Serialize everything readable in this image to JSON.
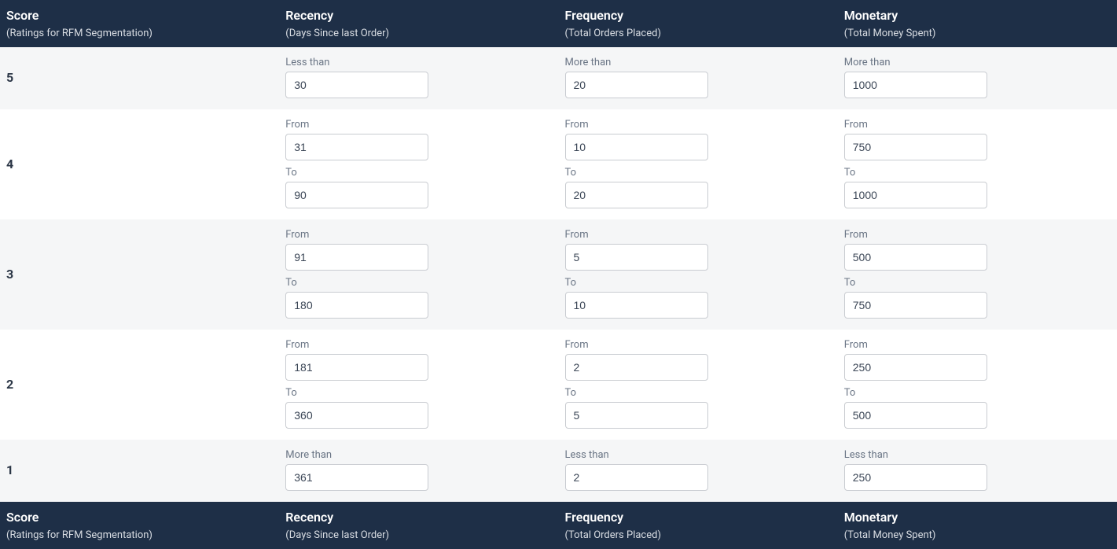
{
  "headers": {
    "score": {
      "title": "Score",
      "sub": "(Ratings for RFM Segmentation)"
    },
    "recency": {
      "title": "Recency",
      "sub": "(Days Since last Order)"
    },
    "frequency": {
      "title": "Frequency",
      "sub": "(Total Orders Placed)"
    },
    "monetary": {
      "title": "Monetary",
      "sub": "(Total Money Spent)"
    }
  },
  "labels": {
    "less_than": "Less than",
    "more_than": "More than",
    "from": "From",
    "to": "To"
  },
  "rows": [
    {
      "score": "5",
      "recency": {
        "mode": "less",
        "value": "30"
      },
      "frequency": {
        "mode": "more",
        "value": "20"
      },
      "monetary": {
        "mode": "more",
        "value": "1000"
      }
    },
    {
      "score": "4",
      "recency": {
        "mode": "range",
        "from": "31",
        "to": "90"
      },
      "frequency": {
        "mode": "range",
        "from": "10",
        "to": "20"
      },
      "monetary": {
        "mode": "range",
        "from": "750",
        "to": "1000"
      }
    },
    {
      "score": "3",
      "recency": {
        "mode": "range",
        "from": "91",
        "to": "180"
      },
      "frequency": {
        "mode": "range",
        "from": "5",
        "to": "10"
      },
      "monetary": {
        "mode": "range",
        "from": "500",
        "to": "750"
      }
    },
    {
      "score": "2",
      "recency": {
        "mode": "range",
        "from": "181",
        "to": "360"
      },
      "frequency": {
        "mode": "range",
        "from": "2",
        "to": "5"
      },
      "monetary": {
        "mode": "range",
        "from": "250",
        "to": "500"
      }
    },
    {
      "score": "1",
      "recency": {
        "mode": "more",
        "value": "361"
      },
      "frequency": {
        "mode": "less",
        "value": "2"
      },
      "monetary": {
        "mode": "less",
        "value": "250"
      }
    }
  ]
}
